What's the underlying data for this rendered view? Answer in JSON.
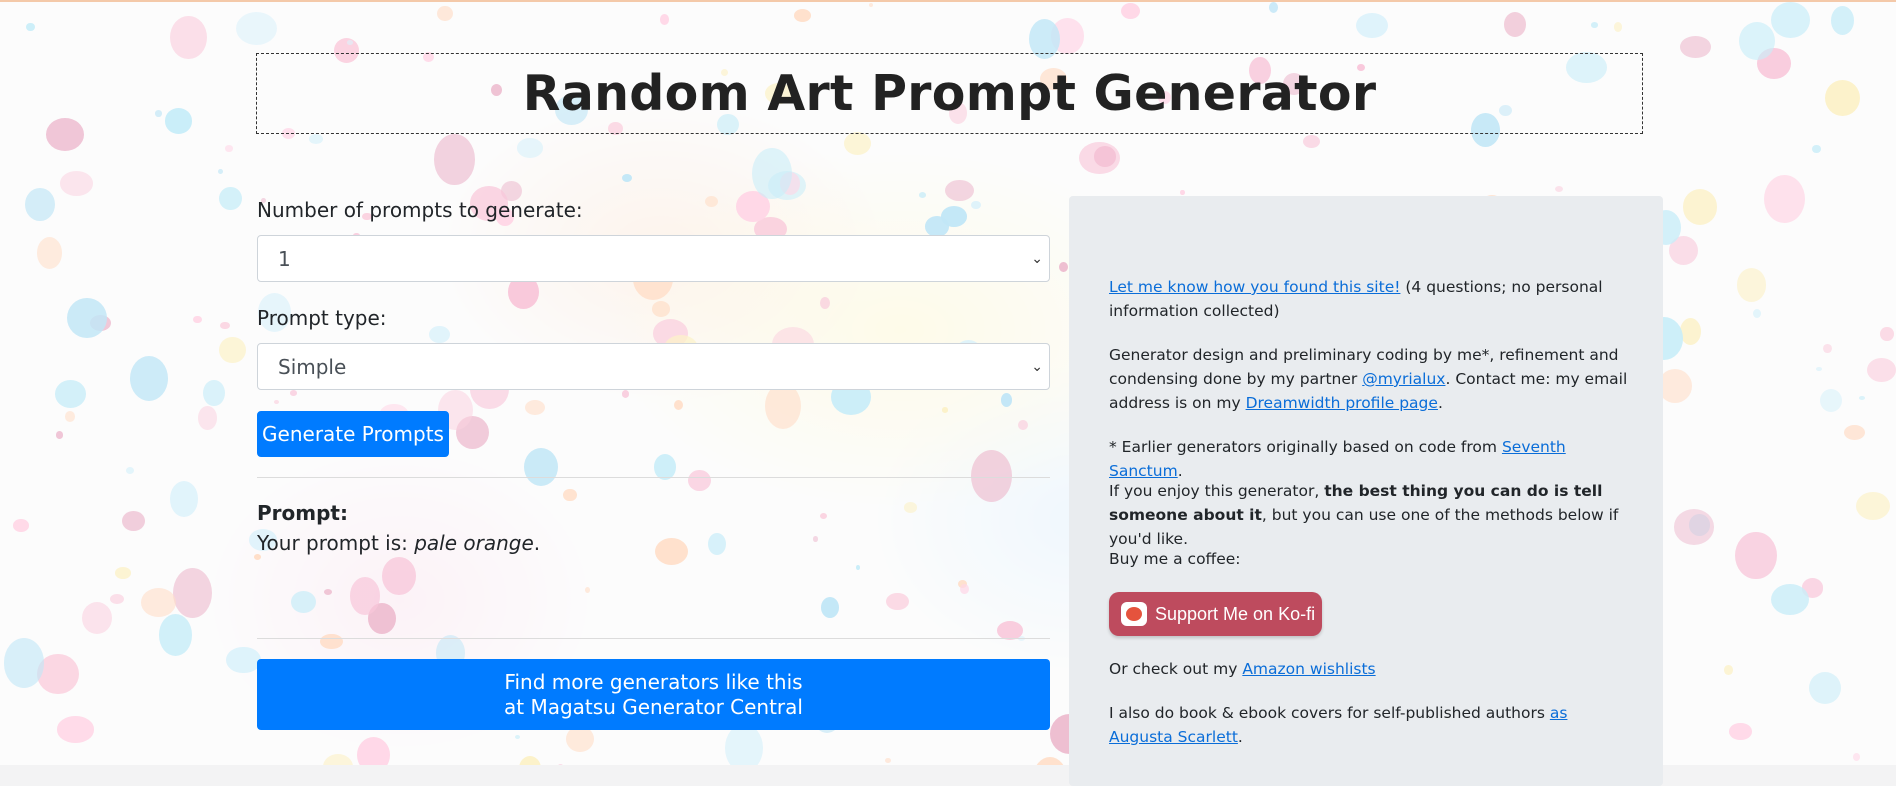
{
  "header": {
    "title": "Random Art Prompt Generator"
  },
  "form": {
    "count_label": "Number of prompts to generate:",
    "count_value": "1",
    "type_label": "Prompt type:",
    "type_value": "Simple",
    "generate_label": "Generate Prompts"
  },
  "result": {
    "heading": "Prompt:",
    "prefix": "Your prompt is: ",
    "value": "pale orange",
    "suffix": "."
  },
  "more_button": {
    "line1": "Find more generators like this",
    "line2": "at Magatsu Generator Central"
  },
  "sidebar": {
    "survey_link": "Let me know how you found this site!",
    "survey_text": " (4 questions; no personal information collected)",
    "credits_text1": "Generator design and preliminary coding by me*, refinement and condensing done by my partner ",
    "credits_link1": "@myrialux",
    "credits_text2": ". Contact me: my email address is on my ",
    "credits_link2": "Dreamwidth profile page",
    "credits_text3": ".",
    "earlier_text": "* Earlier generators originally based on code from ",
    "earlier_link": "Seventh Sanctum",
    "earlier_end": ".",
    "enjoy_text1": "If you enjoy this generator, ",
    "enjoy_bold": "the best thing you can do is tell someone about it",
    "enjoy_text2": ", but you can use one of the methods below if you'd like.",
    "coffee_text": "Buy me a coffee:",
    "kofi_label": "Support Me on Ko-fi",
    "wishlist_text": "Or check out my ",
    "wishlist_link": "Amazon wishlists",
    "covers_text": "I also do book & ebook covers for self-published authors ",
    "covers_link": "as Augusta Scarlett",
    "covers_end": "."
  },
  "colors": {
    "primary": "#007bff",
    "sidebar_bg": "#e9ecef",
    "kofi": "#be4b5e"
  }
}
